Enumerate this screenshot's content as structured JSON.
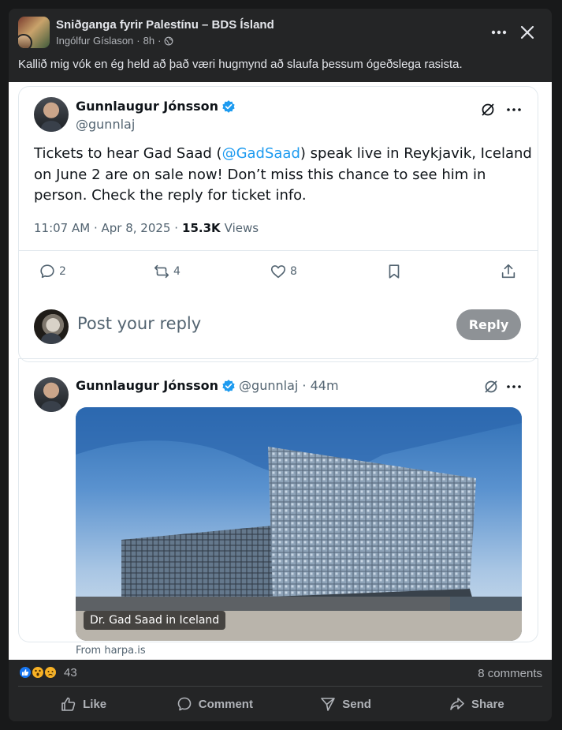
{
  "header": {
    "group_name": "Sniðganga fyrir Palestínu – BDS Ísland",
    "author": "Ingólfur Gíslason",
    "time": "8h",
    "separator": "·"
  },
  "caption": "Kallið mig vók en ég held að það væri hugmynd að slaufa þessum ógeðslega rasista.",
  "tweet": {
    "author_name": "Gunnlaugur Jónsson",
    "handle": "@gunnlaj",
    "text_before": "Tickets to hear Gad Saad (",
    "mention": "@GadSaad",
    "text_after": ") speak live in Reykjavik, Iceland on June 2 are on sale now! Don’t miss this chance to see him in person. Check the reply for ticket info.",
    "time": "11:07 AM · Apr 8, 2025 ·",
    "views_count": "15.3K",
    "views_label": "Views",
    "replies": "2",
    "reposts": "4",
    "likes": "8"
  },
  "reply_box": {
    "placeholder": "Post your reply",
    "button": "Reply"
  },
  "reply_tweet": {
    "author_name": "Gunnlaugur Jónsson",
    "handle_time": "@gunnlaj · 44m",
    "image_caption": "Dr. Gad Saad in Iceland",
    "link_source": "From harpa.is"
  },
  "engagement": {
    "reaction_count": "43",
    "comments": "8 comments"
  },
  "actions": {
    "like": "Like",
    "comment": "Comment",
    "send": "Send",
    "share": "Share"
  },
  "colors": {
    "fb_bg": "#242526",
    "x_blue": "#1d9bf0",
    "verified": "#1d9bf0",
    "reply_button": "#8e9296"
  },
  "icons": [
    "globe-icon",
    "more-icon",
    "close-icon",
    "verified-icon",
    "grok-icon",
    "reply-icon",
    "repost-icon",
    "like-icon",
    "bookmark-icon",
    "share-icon",
    "like-reaction-icon",
    "wow-reaction-icon",
    "sad-reaction-icon",
    "thumb-icon",
    "comment-icon",
    "send-icon",
    "share-arrow-icon"
  ]
}
